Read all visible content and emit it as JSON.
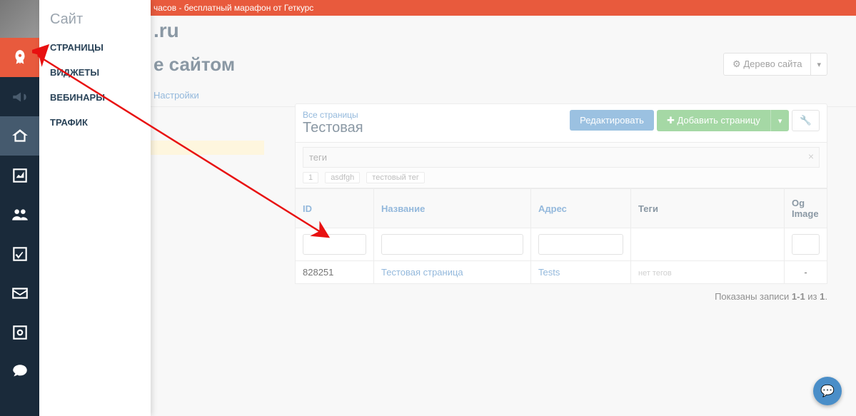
{
  "banner": {
    "text": "часов - бесплатный марафон от Геткурс"
  },
  "header": {
    "site_suffix": ".ru"
  },
  "flyout": {
    "title": "Сайт",
    "items": [
      "СТРАНИЦЫ",
      "ВИДЖЕТЫ",
      "ВЕБИНАРЫ",
      "ТРАФИК"
    ]
  },
  "page": {
    "title": "е сайтом",
    "tree_btn": "Дерево сайта",
    "gear_glyph": "⚙",
    "caret": "▾",
    "tab_settings": "Настройки"
  },
  "panel": {
    "all_pages": "Все страницы",
    "title": "Тестовая",
    "edit_btn": "Редактировать",
    "add_btn": "Добавить страницу",
    "plus": "✚",
    "caret": "▾",
    "wrench": "🔧"
  },
  "tags": {
    "placeholder": "теги",
    "clear": "×",
    "chips": [
      "1",
      "asdfgh",
      "тестовый тег"
    ]
  },
  "table": {
    "headers": {
      "id": "ID",
      "name": "Название",
      "addr": "Адрес",
      "tags": "Теги",
      "og": "Og Image"
    },
    "row": {
      "id": "828251",
      "name": "Тестовая страница",
      "addr": "Tests",
      "tags": "нет тегов",
      "og": "-"
    }
  },
  "pager": {
    "prefix": "Показаны записи ",
    "range": "1-1",
    "mid": " из ",
    "total": "1",
    "dot": "."
  },
  "chat": {
    "glyph": "💬"
  }
}
